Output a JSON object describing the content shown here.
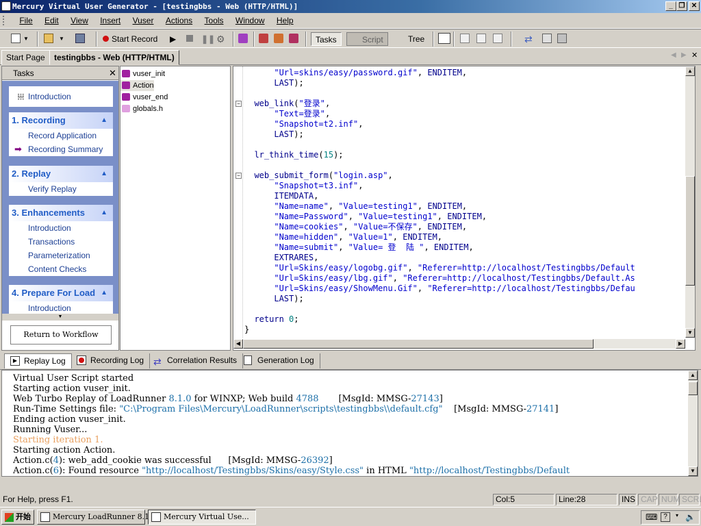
{
  "window": {
    "title": "Mercury Virtual User Generator - [testingbbs - Web (HTTP/HTML)]",
    "controls": {
      "minimize": "_",
      "restore": "❐",
      "close": "✕"
    }
  },
  "menu": [
    "File",
    "Edit",
    "View",
    "Insert",
    "Vuser",
    "Actions",
    "Tools",
    "Window",
    "Help"
  ],
  "toolbar": {
    "start_record": "Start Record",
    "tasks": "Tasks",
    "script": "Script",
    "tree": "Tree"
  },
  "doc_tabs": [
    "Start Page",
    "testingbbs - Web (HTTP/HTML)"
  ],
  "tasks_pane": {
    "title": "Tasks",
    "intro": "Introduction",
    "groups": [
      {
        "title": "1. Recording",
        "items": [
          "Record Application",
          "Recording Summary"
        ]
      },
      {
        "title": "2. Replay",
        "items": [
          "Verify Replay"
        ]
      },
      {
        "title": "3. Enhancements",
        "items": [
          "Introduction",
          "Transactions",
          "Parameterization",
          "Content Checks"
        ]
      },
      {
        "title": "4. Prepare For Load",
        "items": [
          "Introduction"
        ]
      }
    ],
    "return_button": "Return to Workflow"
  },
  "tree": [
    "vuser_init",
    "Action",
    "vuser_end",
    "globals.h"
  ],
  "code_lines": [
    "      \"Url=skins/easy/password.gif\", ENDITEM,",
    "      LAST);",
    "",
    "  web_link(\"登录\",",
    "      \"Text=登录\",",
    "      \"Snapshot=t2.inf\",",
    "      LAST);",
    "",
    "  lr_think_time(15);",
    "",
    "  web_submit_form(\"login.asp\",",
    "      \"Snapshot=t3.inf\",",
    "      ITEMDATA,",
    "      \"Name=name\", \"Value=testing1\", ENDITEM,",
    "      \"Name=Password\", \"Value=testing1\", ENDITEM,",
    "      \"Name=cookies\", \"Value=不保存\", ENDITEM,",
    "      \"Name=hidden\", \"Value=1\", ENDITEM,",
    "      \"Name=submit\", \"Value= 登  陆 \", ENDITEM,",
    "      EXTRARES,",
    "      \"Url=Skins/easy/logobg.gif\", \"Referer=http://localhost/Testingbbs/Default",
    "      \"Url=Skins/easy/lbg.gif\", \"Referer=http://localhost/Testingbbs/Default.As",
    "      \"Url=Skins/easy/ShowMenu.Gif\", \"Referer=http://localhost/Testingbbs/Defau",
    "      LAST);",
    "",
    "  return 0;",
    "}"
  ],
  "output_tabs": [
    "Replay Log",
    "Recording Log",
    "Correlation Results",
    "Generation Log"
  ],
  "output_lines": [
    "Virtual User Script started",
    "Starting action vuser_init.",
    "Web Turbo Replay of LoadRunner 8.1.0 for WINXP; Web build 4788       [MsgId: MMSG-27143]",
    "Run-Time Settings file: \"C:\\Program Files\\Mercury\\LoadRunner\\scripts\\testingbbs\\\\default.cfg\"    [MsgId: MMSG-27141]",
    "Ending action vuser_init.",
    "Running Vuser...",
    "Starting iteration 1.",
    "Starting action Action.",
    "Action.c(4): web_add_cookie was successful      [MsgId: MMSG-26392]",
    "Action.c(6): Found resource \"http://localhost/Testingbbs/Skins/easy/Style.css\" in HTML \"http://localhost/Testingbbs/Default"
  ],
  "status": {
    "help": "For Help, press F1.",
    "col": "Col:5",
    "line": "Line:28",
    "ins": "INS",
    "cap": "CAP",
    "num": "NUM",
    "scrl": "SCRL"
  },
  "taskbar": {
    "start": "开始",
    "tasks": [
      "Mercury LoadRunner 8.1",
      "Mercury Virtual Use..."
    ]
  },
  "colors": {
    "title_bar": "#0a246a",
    "task_pane_bg": "#7a8fc8",
    "task_link": "#1c3f94",
    "orange_log": "#e8a060"
  }
}
